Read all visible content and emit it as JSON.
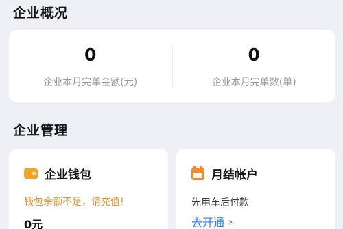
{
  "overview": {
    "title": "企业概况",
    "stats": [
      {
        "value": "0",
        "label": "企业本月完单金额(元)"
      },
      {
        "value": "0",
        "label": "企业本月完单数(单)"
      }
    ]
  },
  "management": {
    "title": "企业管理",
    "wallet": {
      "icon": "wallet-icon",
      "title": "企业钱包",
      "warning": "钱包余额不足，请充值!",
      "balance": "0元"
    },
    "monthly_account": {
      "icon": "calendar-icon",
      "title": "月结帐户",
      "description": "先用车后付款",
      "link_label": "去开通",
      "chevron": "›"
    }
  }
}
